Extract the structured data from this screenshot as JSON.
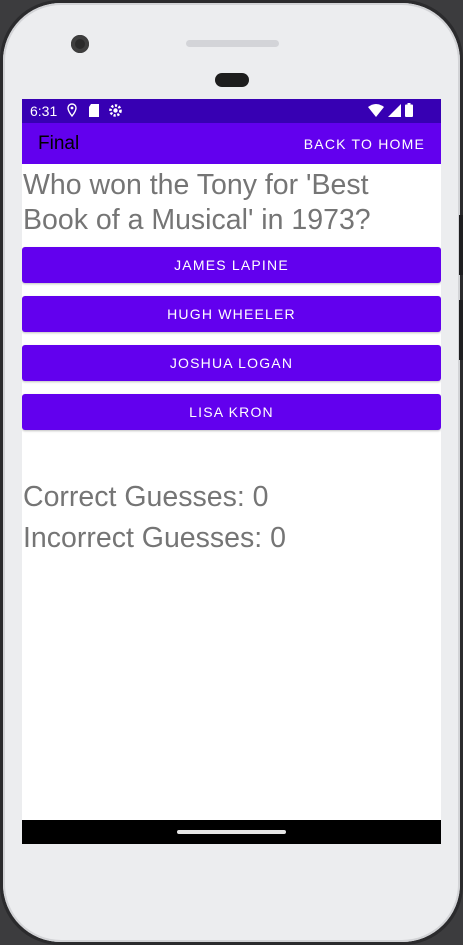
{
  "status_bar": {
    "time": "6:31",
    "left_icons": [
      "location-icon",
      "sd-card-icon",
      "settings-icon"
    ],
    "right_icons": [
      "wifi-icon",
      "cellular-icon",
      "battery-icon"
    ],
    "background": "#3700b3"
  },
  "app_bar": {
    "title": "Final",
    "action_label": "BACK TO HOME",
    "background": "#6200ee"
  },
  "question": {
    "text": "Who won the Tony for 'Best Book of a Musical' in 1973?"
  },
  "answers": [
    {
      "label": "JAMES LAPINE"
    },
    {
      "label": "HUGH WHEELER"
    },
    {
      "label": "JOSHUA LOGAN"
    },
    {
      "label": "LISA KRON"
    }
  ],
  "score": {
    "correct": "Correct Guesses: 0",
    "incorrect": "Incorrect Guesses: 0"
  },
  "colors": {
    "accent": "#6200ee",
    "text_gray": "#757575"
  }
}
